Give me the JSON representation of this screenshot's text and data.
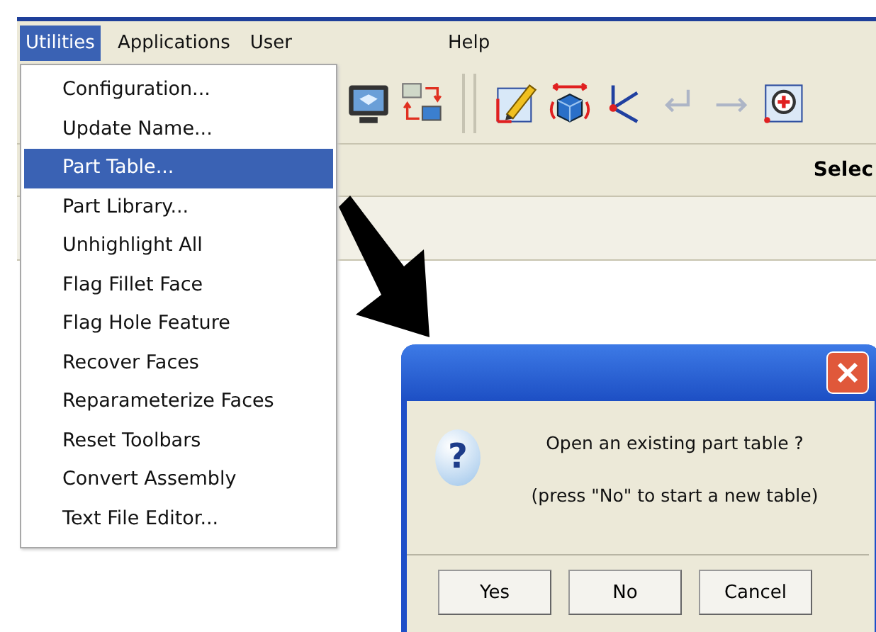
{
  "menu_bar": [
    {
      "label": "Utilities",
      "selected": true
    },
    {
      "label": "Applications",
      "selected": false
    },
    {
      "label": "User",
      "selected": false
    },
    {
      "label": "Help",
      "selected": false
    }
  ],
  "toolbar": [
    {
      "kind": "display",
      "disabled": false
    },
    {
      "kind": "transfer",
      "disabled": false
    },
    {
      "kind": "separator"
    },
    {
      "kind": "sketch",
      "disabled": false
    },
    {
      "kind": "rotate",
      "disabled": false
    },
    {
      "kind": "axes",
      "disabled": false
    },
    {
      "kind": "back",
      "disabled": true
    },
    {
      "kind": "forward",
      "disabled": true
    },
    {
      "kind": "zoom",
      "disabled": false
    }
  ],
  "status_text": "Selec",
  "dropdown": [
    {
      "label": "Configuration...",
      "selected": false
    },
    {
      "label": "Update Name...",
      "selected": false
    },
    {
      "label": "Part Table...",
      "selected": true
    },
    {
      "label": "Part Library...",
      "selected": false
    },
    {
      "label": "Unhighlight All",
      "selected": false
    },
    {
      "label": "Flag Fillet Face",
      "selected": false
    },
    {
      "label": "Flag Hole Feature",
      "selected": false
    },
    {
      "label": "Recover Faces",
      "selected": false
    },
    {
      "label": "Reparameterize Faces",
      "selected": false
    },
    {
      "label": "Reset Toolbars",
      "selected": false
    },
    {
      "label": "Convert Assembly",
      "selected": false
    },
    {
      "label": "Text File Editor...",
      "selected": false
    }
  ],
  "dialog": {
    "icon_glyph": "?",
    "message": "Open an existing part table ?",
    "hint": "(press \"No\" to start a new table)",
    "buttons": [
      "Yes",
      "No",
      "Cancel"
    ]
  }
}
